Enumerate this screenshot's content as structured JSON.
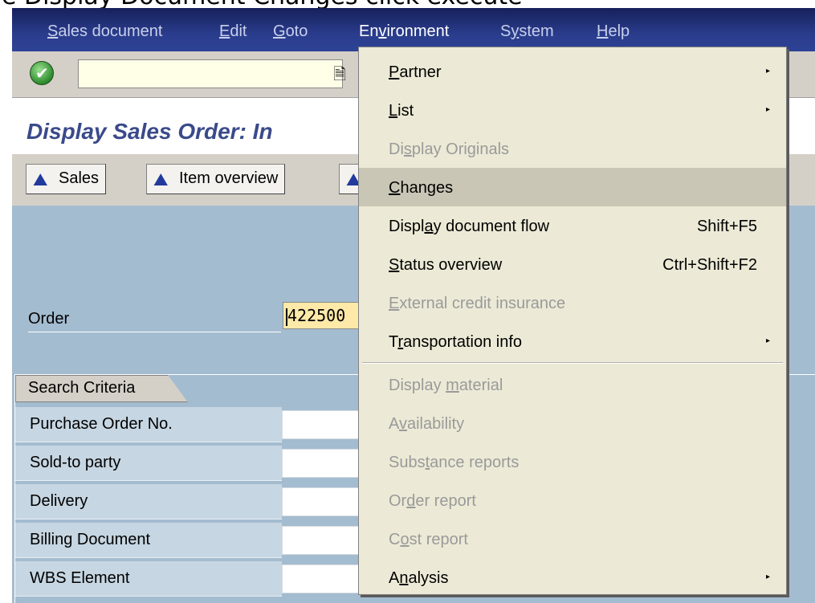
{
  "caption": "e Display Document Changes click execute",
  "menubar": {
    "items": [
      {
        "pre": "",
        "u": "S",
        "post": "ales document"
      },
      {
        "pre": "",
        "u": "E",
        "post": "dit"
      },
      {
        "pre": "",
        "u": "G",
        "post": "oto"
      },
      {
        "pre": "En",
        "u": "v",
        "post": "ironment"
      },
      {
        "pre": "S",
        "u": "y",
        "post": "stem"
      },
      {
        "pre": "",
        "u": "H",
        "post": "elp"
      }
    ]
  },
  "toolbar": {
    "command_value": ""
  },
  "title": "Display Sales Order: In",
  "app_toolbar": {
    "buttons": [
      {
        "label": "Sales",
        "icon": "mountain-icon"
      },
      {
        "label": "Item overview",
        "icon": "mountain-icon"
      }
    ]
  },
  "form": {
    "order_label": "Order",
    "order_value": "422500",
    "group_title": "Search Criteria",
    "rows": [
      {
        "label": "Purchase Order No."
      },
      {
        "label": "Sold-to party"
      },
      {
        "label": "Delivery"
      },
      {
        "label": "Billing Document"
      },
      {
        "label": "WBS Element"
      }
    ]
  },
  "menu": {
    "items": [
      {
        "pre": "",
        "u": "P",
        "post": "artner",
        "disabled": false,
        "submenu": true,
        "shortcut": ""
      },
      {
        "pre": "",
        "u": "L",
        "post": "ist",
        "disabled": false,
        "submenu": true,
        "shortcut": ""
      },
      {
        "pre": "Di",
        "u": "s",
        "post": "play Originals",
        "disabled": true,
        "submenu": false,
        "shortcut": ""
      },
      {
        "pre": "",
        "u": "C",
        "post": "hanges",
        "disabled": false,
        "submenu": false,
        "shortcut": "",
        "highlighted": true
      },
      {
        "pre": "Displ",
        "u": "a",
        "post": "y document flow",
        "disabled": false,
        "submenu": false,
        "shortcut": "Shift+F5"
      },
      {
        "pre": "",
        "u": "S",
        "post": "tatus overview",
        "disabled": false,
        "submenu": false,
        "shortcut": "Ctrl+Shift+F2"
      },
      {
        "pre": "",
        "u": "E",
        "post": "xternal credit insurance",
        "disabled": true,
        "submenu": false,
        "shortcut": ""
      },
      {
        "pre": "T",
        "u": "r",
        "post": "ansportation info",
        "disabled": false,
        "submenu": true,
        "shortcut": ""
      },
      {
        "pre": "Display ",
        "u": "m",
        "post": "aterial",
        "disabled": true,
        "submenu": false,
        "shortcut": ""
      },
      {
        "pre": "A",
        "u": "v",
        "post": "ailability",
        "disabled": true,
        "submenu": false,
        "shortcut": ""
      },
      {
        "pre": "Subs",
        "u": "t",
        "post": "ance reports",
        "disabled": true,
        "submenu": false,
        "shortcut": ""
      },
      {
        "pre": "Or",
        "u": "d",
        "post": "er report",
        "disabled": true,
        "submenu": false,
        "shortcut": ""
      },
      {
        "pre": "C",
        "u": "o",
        "post": "st report",
        "disabled": true,
        "submenu": false,
        "shortcut": ""
      },
      {
        "pre": "A",
        "u": "n",
        "post": "alysis",
        "disabled": false,
        "submenu": true,
        "shortcut": ""
      }
    ]
  }
}
